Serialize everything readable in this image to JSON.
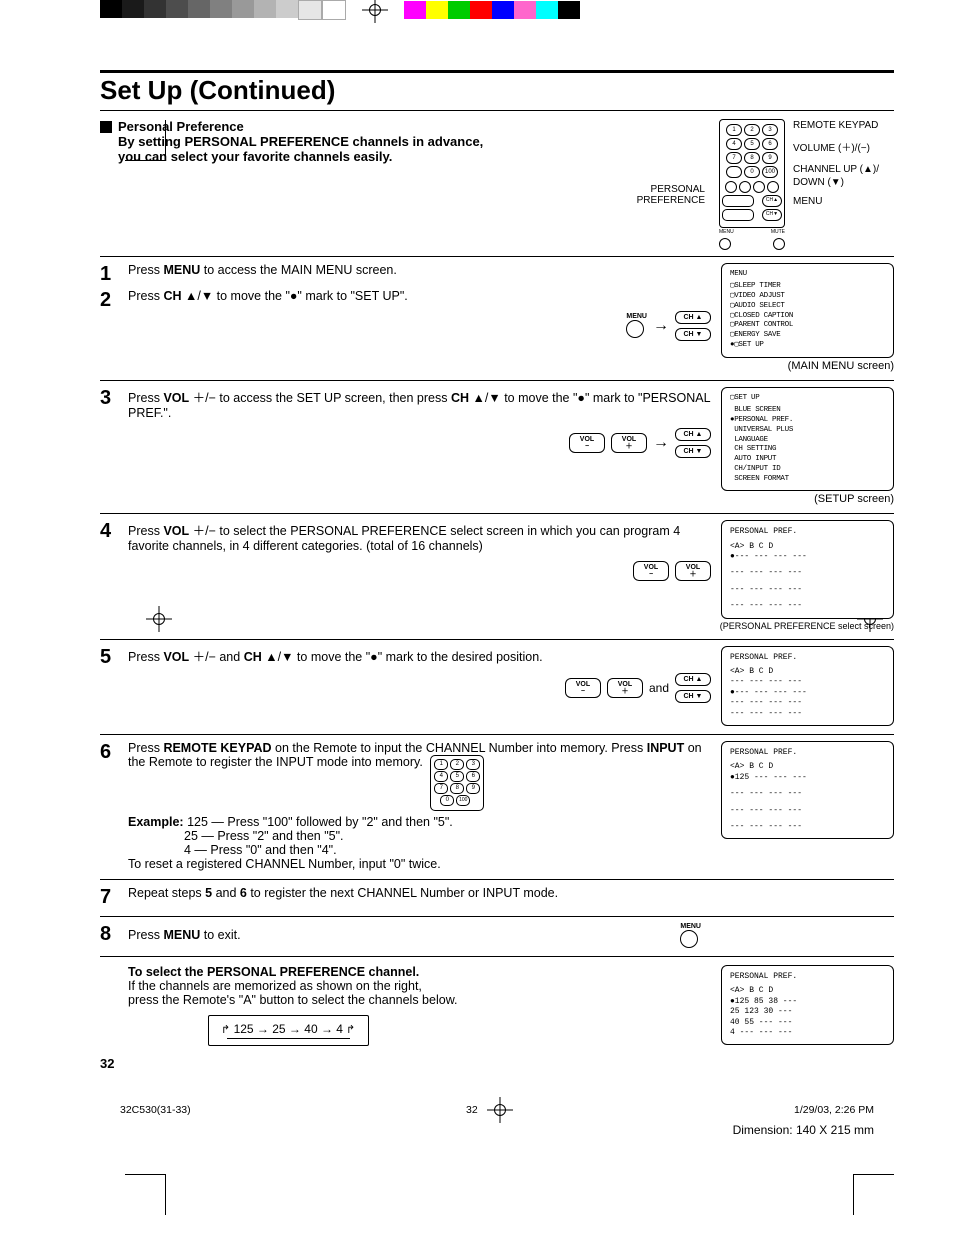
{
  "title": "Set Up (Continued)",
  "intro": {
    "heading": "Personal Preference",
    "text": "By setting PERSONAL PREFERENCE channels in advance, you can select your favorite channels easily."
  },
  "remote": {
    "pp_label": "PERSONAL\nPREFERENCE",
    "labels": [
      "REMOTE KEYPAD",
      "VOLUME (＋)/(−)",
      "CHANNEL UP (▲)/ DOWN (▼)",
      "MENU"
    ]
  },
  "steps": [
    {
      "n": "1",
      "text_parts": [
        "Press ",
        "MENU",
        " to access the MAIN MENU screen."
      ]
    },
    {
      "n": "2",
      "text_parts": [
        "Press ",
        "CH",
        " ▲/▼ to move the \"●\" mark to \"SET UP\"."
      ]
    },
    {
      "n": "3",
      "text_parts": [
        "Press ",
        "VOL",
        " ＋/− to access the SET UP screen, then press ",
        "CH",
        " ▲/▼ to move the \"●\" mark to \"PERSONAL PREF.\"."
      ]
    },
    {
      "n": "4",
      "text_parts": [
        "Press ",
        "VOL",
        " ＋/− to select the PERSONAL PREFERENCE select screen in which you can program 4 favorite channels, in 4 different categories. (total of 16 channels)"
      ]
    },
    {
      "n": "5",
      "text_parts": [
        "Press ",
        "VOL",
        " ＋/− and ",
        "CH",
        " ▲/▼ to move the \"●\" mark to the desired position."
      ]
    },
    {
      "n": "6",
      "text_parts": [
        "Press ",
        "REMOTE KEYPAD",
        " on the Remote to input the CHANNEL Number into memory. Press ",
        "INPUT",
        " on the Remote to register the INPUT mode into memory."
      ],
      "example_label": "Example:",
      "example_lines": [
        "125 — Press \"100\" followed by \"2\" and then \"5\".",
        "  25 — Press \"2\" and then \"5\".",
        "   4   — Press \"0\" and then \"4\".",
        "To reset a registered CHANNEL Number, input \"0\" twice."
      ]
    },
    {
      "n": "7",
      "text_parts": [
        "Repeat steps ",
        "5",
        " and ",
        "6",
        " to register the next CHANNEL Number or INPUT mode."
      ]
    },
    {
      "n": "8",
      "text_parts": [
        "Press ",
        "MENU",
        " to exit."
      ]
    }
  ],
  "controls": {
    "menu": "MENU",
    "ch_up": "CH ▲",
    "ch_dn": "CH ▼",
    "vol_m": "VOL\n−",
    "vol_p": "VOL\n＋",
    "and": "and"
  },
  "screens": {
    "main_menu": {
      "title": "MENU",
      "items": [
        "SLEEP TIMER",
        "VIDEO ADJUST",
        "AUDIO SELECT",
        "CLOSED CAPTION",
        "PARENT CONTROL",
        "ENERGY SAVE",
        "SET UP"
      ],
      "caption": "(MAIN MENU screen)"
    },
    "setup": {
      "title": "SET UP",
      "items": [
        "BLUE SCREEN",
        "PERSONAL PREF.",
        "UNIVERSAL PLUS",
        "LANGUAGE",
        "CH SETTING",
        "AUTO INPUT",
        "CH/INPUT ID",
        "SCREEN FORMAT"
      ],
      "caption": "(SETUP screen)"
    },
    "pp_select": {
      "title": "PERSONAL PREF.",
      "header": "<A>  B   C   D",
      "rows": [
        "●--- --- --- ---",
        " --- --- --- ---",
        " --- --- --- ---",
        " --- --- --- ---"
      ],
      "caption": "(PERSONAL PREFERENCE select screen)"
    },
    "pp_pos": {
      "title": "PERSONAL PREF.",
      "header": "<A>  B   C   D",
      "rows": [
        " --- --- --- ---",
        "●--- --- --- ---",
        " --- --- --- ---",
        " --- --- --- ---"
      ]
    },
    "pp_125": {
      "title": "PERSONAL PREF.",
      "header": "<A>  B   C   D",
      "rows": [
        "●125 --- --- ---",
        " --- --- --- ---",
        " --- --- --- ---",
        " --- --- --- ---"
      ]
    },
    "pp_final": {
      "title": "PERSONAL PREF.",
      "header": "<A>  B   C   D",
      "rows": [
        "●125  85  38 ---",
        "  25 123  30 ---",
        "  40  55 --- ---",
        "   4 --- --- ---"
      ]
    }
  },
  "select_section": {
    "heading": "To select the PERSONAL PREFERENCE channel.",
    "line1": "If the channels are memorized as shown on the right,",
    "line2": "press the Remote's \"A\" button to select the channels below.",
    "cycle": "125 → 25 → 40 → 4"
  },
  "page_number": "32",
  "footer": {
    "file": "32C530(31-33)",
    "mid": "32",
    "date": "1/29/03, 2:26 PM",
    "dim": "Dimension: 140  X 215 mm"
  }
}
